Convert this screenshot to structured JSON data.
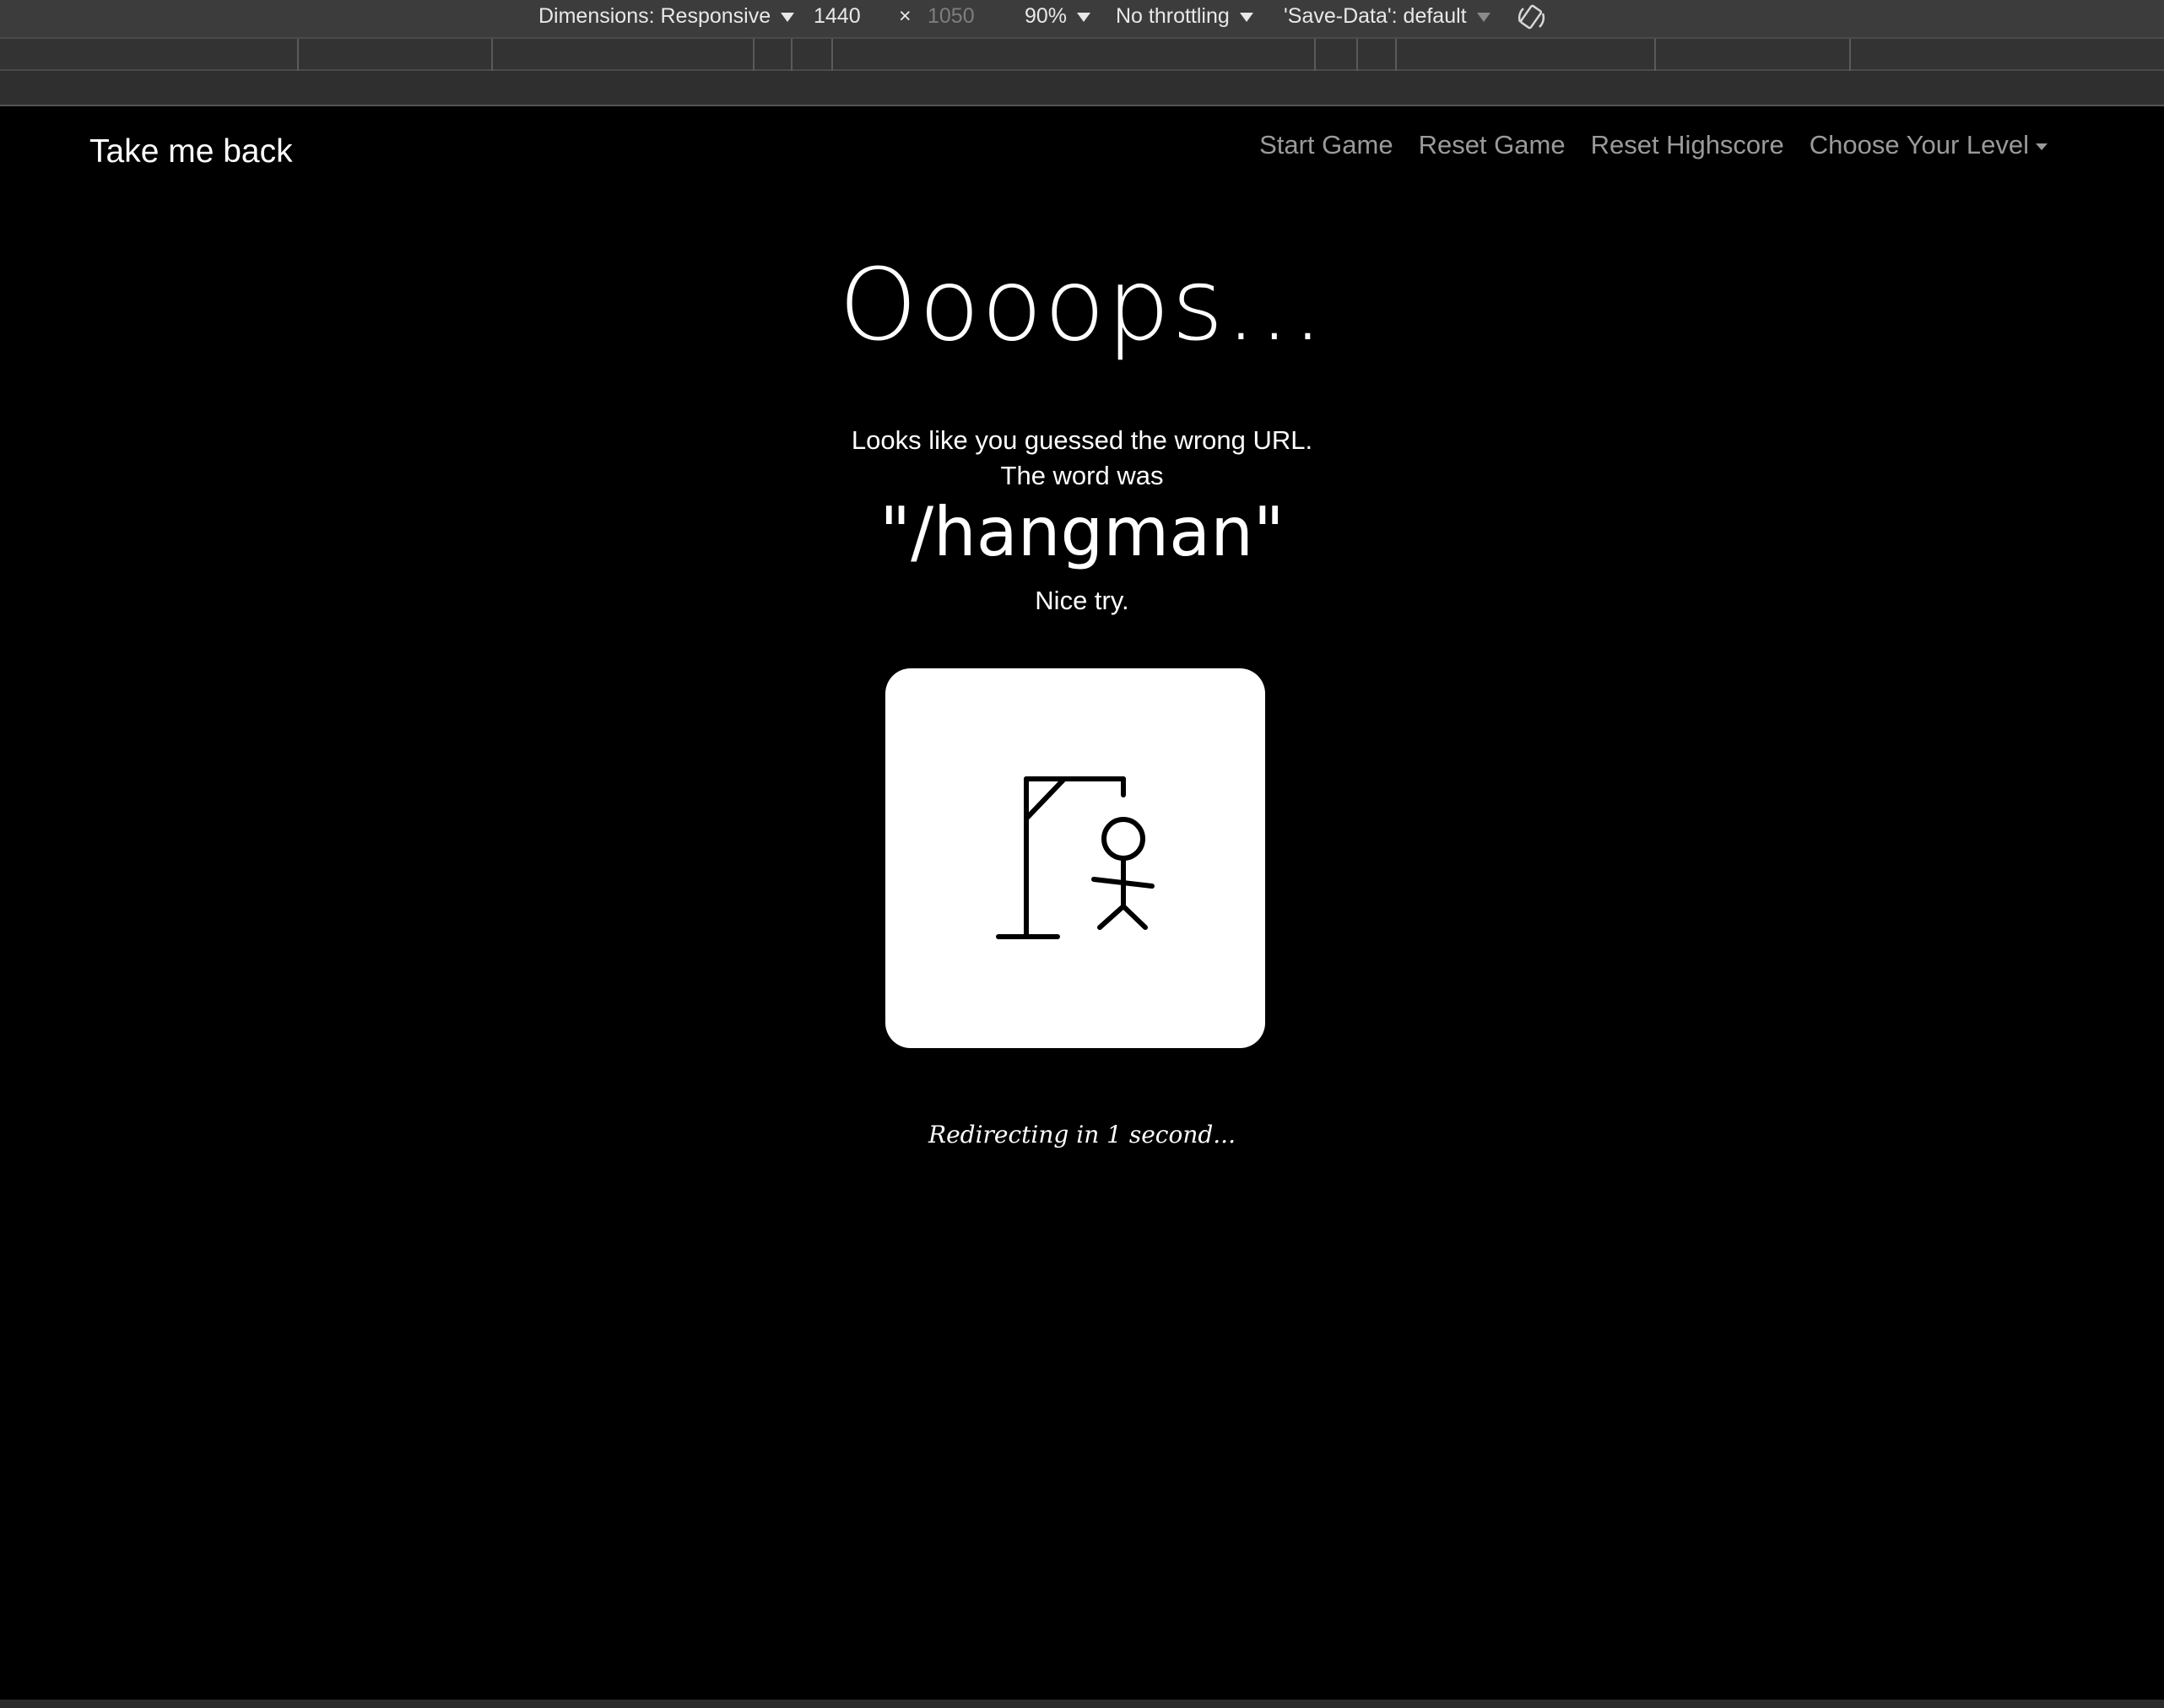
{
  "devtools": {
    "dimensions_label": "Dimensions: Responsive",
    "width": "1440",
    "times": "×",
    "height": "1050",
    "zoom": "90%",
    "throttling": "No throttling",
    "save_data": "'Save-Data': default",
    "rotate_icon": "rotate-icon"
  },
  "navbar": {
    "brand": "Take me back",
    "links": [
      "Start Game",
      "Reset Game",
      "Reset Highscore",
      "Choose Your Level"
    ]
  },
  "main": {
    "headline": "Oooops...",
    "message_line1": "Looks like you guessed the wrong URL.",
    "message_line2": "The word was",
    "word": "\"/hangman\"",
    "message_line3": "Nice try.",
    "image": "hangman-figure",
    "redirect_text": "Redirecting in 1 second..."
  },
  "colors": {
    "background": "#000000",
    "text": "#ffffff",
    "nav_link": "#9a9a9a",
    "card": "#ffffff",
    "devtools_bar": "#3c3c3c"
  }
}
